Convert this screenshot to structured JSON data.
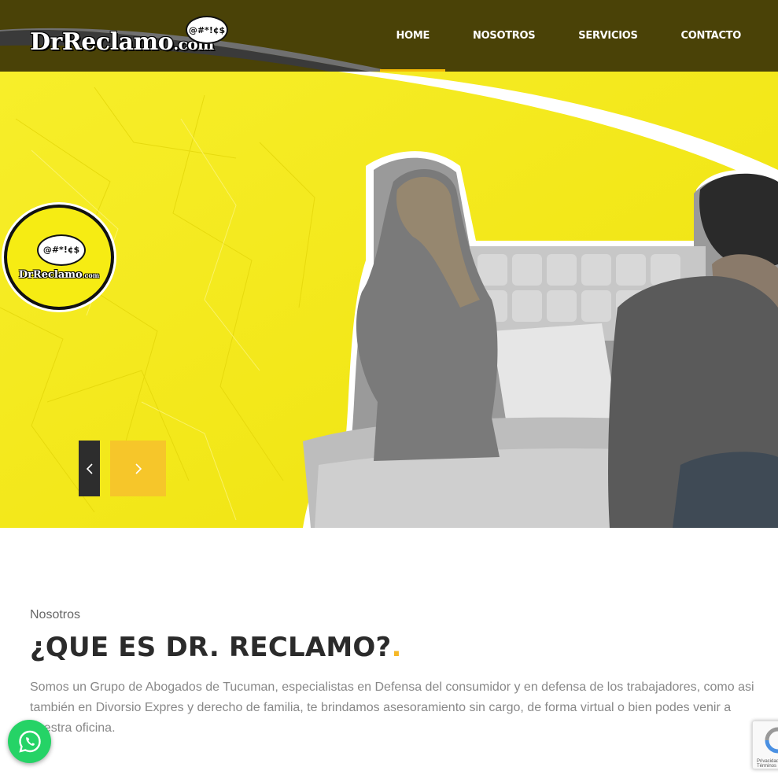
{
  "header": {
    "logo_text": "DrReclamo",
    "logo_domain": ".com",
    "logo_bubble": "@#*!¢$",
    "nav": [
      {
        "label": "HOME",
        "active": true
      },
      {
        "label": "NOSOTROS",
        "active": false
      },
      {
        "label": "SERVICIOS",
        "active": false
      },
      {
        "label": "CONTACTO",
        "active": false
      }
    ]
  },
  "hero": {
    "circle_logo_bubble": "@#*!¢$",
    "circle_logo_text": "DrReclamo",
    "circle_logo_domain": ".com",
    "prev_icon": "chevron-left-icon",
    "next_icon": "chevron-right-icon"
  },
  "about": {
    "eyebrow": "Nosotros",
    "title": "¿QUE ES DR. RECLAMO?",
    "title_dot": ".",
    "body": "Somos un Grupo de Abogados de Tucuman, especialistas en Defensa del consumidor y en defensa de los trabajadores, como asi también en Divorsio Expres y derecho de familia, te brindamos asesoramiento sin cargo, de forma virtual o bien podes venir a nuestra oficina."
  },
  "floating": {
    "whatsapp_icon": "whatsapp-icon",
    "recaptcha_label": "Privacidad - Términos"
  },
  "colors": {
    "header_bg": "#4a4207",
    "hero_yellow": "#f6ec13",
    "accent": "#f6b827",
    "whatsapp": "#25d366"
  }
}
